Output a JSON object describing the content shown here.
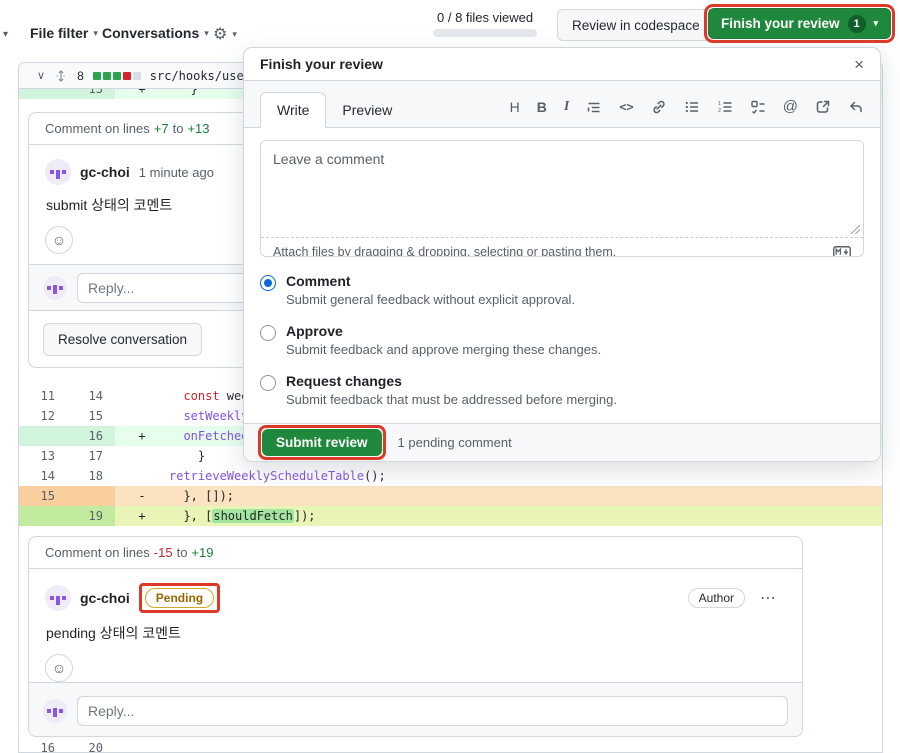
{
  "topbar": {
    "left_caret": "▾",
    "file_filter_label": "File filter",
    "conversations_label": "Conversations",
    "gear_icon": "⚙",
    "caret": "▾",
    "files_viewed": "0 / 8 files viewed",
    "review_in_codespace_label": "Review in codespace",
    "finish_review_label": "Finish your review",
    "finish_review_count": "1"
  },
  "file_header": {
    "chevron_icon": "∨",
    "changes_count": "8",
    "path": "src/hooks/use"
  },
  "popover": {
    "title": "Finish your review",
    "close_icon": "×",
    "tabs": {
      "write": "Write",
      "preview": "Preview"
    },
    "toolbar": {
      "heading": "H",
      "bold": "B",
      "italic": "I",
      "code": "<>",
      "mention": "@"
    },
    "comment_placeholder": "Leave a comment",
    "attach_hint": "Attach files by dragging & dropping, selecting or pasting them.",
    "options": {
      "comment": {
        "label": "Comment",
        "desc": "Submit general feedback without explicit approval."
      },
      "approve": {
        "label": "Approve",
        "desc": "Submit feedback and approve merging these changes."
      },
      "request": {
        "label": "Request changes",
        "desc": "Submit feedback that must be addressed before merging."
      }
    },
    "submit_label": "Submit review",
    "pending_note": "1 pending comment"
  },
  "thread1": {
    "range_label": "Comment on lines",
    "from": "+7",
    "to_word": "to",
    "to": "+13",
    "author": "gc-choi",
    "time": "1 minute ago",
    "body": "submit 상태의 코멘트",
    "smiley_icon": "☺",
    "reply_placeholder": "Reply...",
    "resolve_label": "Resolve conversation"
  },
  "thread2": {
    "range_label": "Comment on lines",
    "from": "-15",
    "to_word": "to",
    "to": "+19",
    "author": "gc-choi",
    "pending_badge": "Pending",
    "author_badge": "Author",
    "kebab_icon": "⋯",
    "body": "pending 상태의 코멘트",
    "smiley_icon": "☺",
    "reply_placeholder": "Reply..."
  },
  "diff": {
    "sliver": {
      "new": "13",
      "sign": "+",
      "code": "   }"
    },
    "rows": [
      {
        "old": "11",
        "new": "14",
        "sign": "",
        "pre": "  ",
        "mid": "const",
        "post": " wee"
      },
      {
        "old": "12",
        "new": "15",
        "sign": "",
        "pre": "  ",
        "mid": "setWeekly",
        "post": ""
      },
      {
        "old": "",
        "new": "16",
        "sign": "+",
        "pre": "  ",
        "mid": "onFetched",
        "post": ""
      },
      {
        "old": "13",
        "new": "17",
        "sign": "",
        "pre": "",
        "mid": "",
        "post": "    }"
      },
      {
        "old": "14",
        "new": "18",
        "sign": "",
        "pre": "",
        "mid": "retrieveWeeklyScheduleTable",
        "post": "();"
      },
      {
        "old": "15",
        "new": "",
        "sign": "-",
        "pre": "",
        "mid": "",
        "post": "  }, []);"
      },
      {
        "old": "",
        "new": "19",
        "sign": "+",
        "pre": "  }, [",
        "mid": "shouldFetch",
        "post": "]);"
      }
    ],
    "bottom": {
      "old": "16",
      "new": "20"
    }
  },
  "colors": {
    "accent_green": "#1f883d",
    "annotation_red": "#dd3928",
    "addition_bg": "#e6ffec",
    "deletion_bg": "#fbe3c2",
    "pending_gold": "#9a6700",
    "radio_blue": "#0969da"
  }
}
